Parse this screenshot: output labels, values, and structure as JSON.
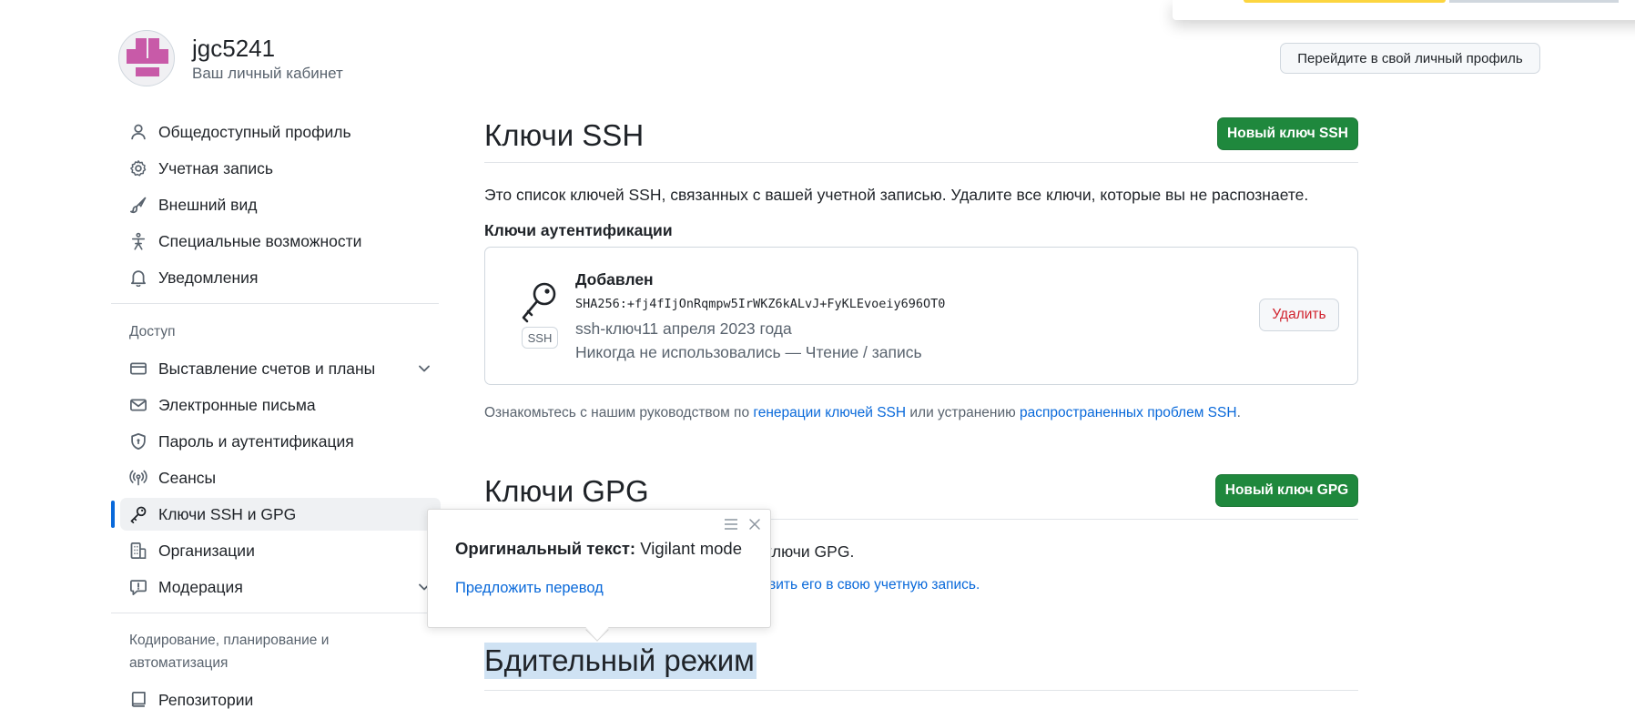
{
  "header": {
    "username": "jgc5241",
    "subtitle": "Ваш личный кабинет",
    "profile_button": "Перейдите в свой личный профиль"
  },
  "sidebar": {
    "items_top": [
      {
        "label": "Общедоступный профиль",
        "icon": "person-icon"
      },
      {
        "label": "Учетная запись",
        "icon": "gear-icon"
      },
      {
        "label": "Внешний вид",
        "icon": "paintbrush-icon"
      },
      {
        "label": "Специальные возможности",
        "icon": "accessibility-icon"
      },
      {
        "label": "Уведомления",
        "icon": "bell-icon"
      }
    ],
    "section_access": "Доступ",
    "items_access": [
      {
        "label": "Выставление счетов и планы",
        "icon": "credit-card-icon"
      },
      {
        "label": "Электронные письма",
        "icon": "mail-icon"
      },
      {
        "label": "Пароль и аутентификация",
        "icon": "shield-lock-icon"
      },
      {
        "label": "Сеансы",
        "icon": "broadcast-icon"
      },
      {
        "label": "Ключи SSH и GPG",
        "icon": "key-icon"
      },
      {
        "label": "Организации",
        "icon": "organization-icon"
      },
      {
        "label": "Модерация",
        "icon": "report-icon"
      }
    ],
    "section_code": "Кодирование, планирование и автоматизация",
    "items_code": [
      {
        "label": "Репозитории",
        "icon": "repo-icon"
      }
    ]
  },
  "main": {
    "ssh_title": "Ключи SSH",
    "new_ssh_button": "Новый ключ SSH",
    "ssh_description": "Это список ключей SSH, связанных с вашей учетной записью. Удалите все ключи, которые вы не распознаете.",
    "auth_keys_heading": "Ключи аутентификации",
    "key": {
      "badge": "SSH",
      "title": "Добавлен",
      "fingerprint": "SHA256:+fj4fIjOnRqmpw5IrWKZ6kALvJ+FyKLEvoeiy696OT0",
      "added": "ssh-ключ11 апреля 2023 года",
      "usage": "Никогда не использовались — Чтение / запись",
      "delete_button": "Удалить"
    },
    "help_prefix": "Ознакомьтесь с нашим руководством по ",
    "help_link1": "генерации ключей SSH",
    "help_middle": " или устранению ",
    "help_link2": "распространенных проблем SSH",
    "help_suffix": ".",
    "gpg_title": "Ключи GPG",
    "new_gpg_button": "Новый ключ GPG",
    "gpg_partial_text": "ключи GPG.",
    "gpg_partial_link": "вить его в свою учетную запись.",
    "vigilant_title": "Бдительный режим"
  },
  "translate_popup": {
    "original_label": "Оригинальный текст:",
    "original_value": "Vigilant mode",
    "suggest_link": "Предложить перевод"
  },
  "colors": {
    "accent_blue": "#0969da",
    "green_button": "#1f883d",
    "danger": "#d1242f",
    "selection": "#cfe2f3",
    "avatar": "#c85aa8"
  }
}
